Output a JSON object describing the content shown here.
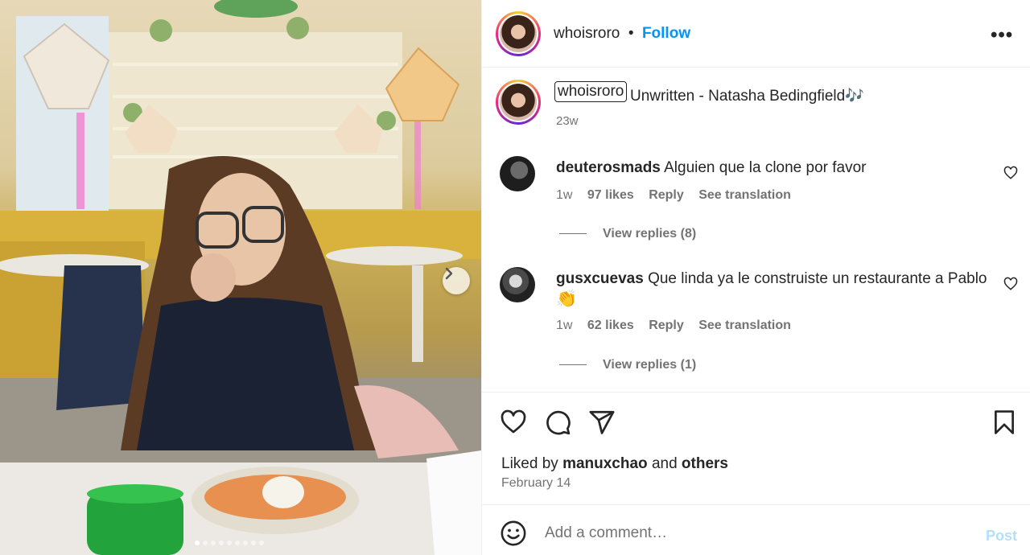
{
  "post": {
    "username": "whoisroro",
    "follow_label": "Follow",
    "separator": "•",
    "more_label": "•••"
  },
  "caption": {
    "username": "whoisroro",
    "text": "Unwritten - Natasha Bedingfield🎶",
    "time": "23w"
  },
  "comments": [
    {
      "username": "deuterosmads",
      "text": "Alguien que la clone por favor",
      "time": "1w",
      "likes": "97 likes",
      "reply_label": "Reply",
      "translate_label": "See translation",
      "view_replies": "View replies (8)"
    },
    {
      "username": "gusxcuevas",
      "text": "Que linda ya le construiste un restaurante a Pablo",
      "text_line2": "👏",
      "time": "1w",
      "likes": "62 likes",
      "reply_label": "Reply",
      "translate_label": "See translation",
      "view_replies": "View replies (1)"
    }
  ],
  "likes": {
    "prefix": "Liked by",
    "user": "manuxchao",
    "middle": "and",
    "others": "others"
  },
  "date": "February 14",
  "comment_box": {
    "placeholder": "Add a comment…",
    "post_label": "Post"
  },
  "carousel": {
    "total_images": 9,
    "current_index": 0
  },
  "colors": {
    "accent": "#0095f6",
    "muted": "#737373",
    "post_disabled": "#b2dffc"
  }
}
